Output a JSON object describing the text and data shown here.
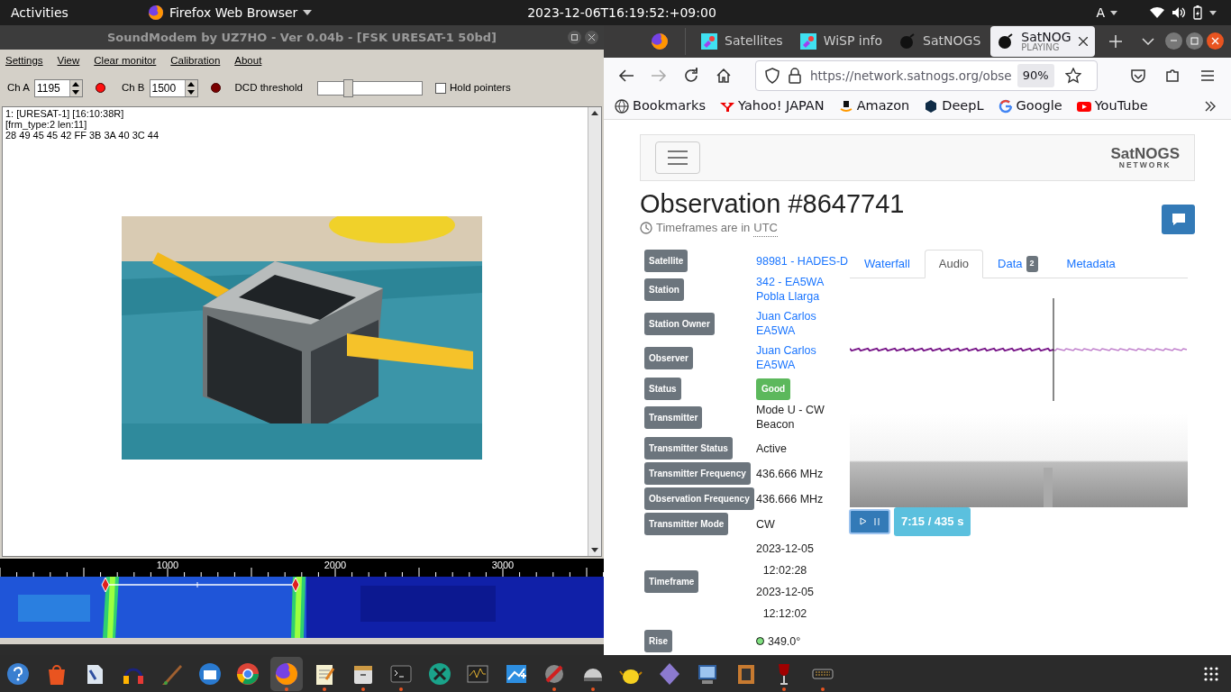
{
  "top_bar": {
    "activities": "Activities",
    "app": "Firefox Web Browser",
    "clock": "2023-12-06T16:19:52:+09:00",
    "input_source": "A"
  },
  "soundmodem": {
    "title": "SoundModem by UZ7HO - Ver 0.04b - [FSK URESAT-1 50bd]",
    "menu": [
      "Settings",
      "View",
      "Clear monitor",
      "Calibration",
      "About"
    ],
    "channels": [
      {
        "label": "Ch A",
        "value": "1195",
        "led_on": true
      },
      {
        "label": "Ch B",
        "value": "1500",
        "led_on": false
      }
    ],
    "dcd": {
      "label": "DCD threshold",
      "level": 0.27
    },
    "hold_pointers": {
      "label": "Hold pointers",
      "checked": false
    },
    "monitor_lines": [
      "1: [URESAT-1] [16:10:38R]",
      "[frm_type:2 len:11]",
      "28 49 45 45 42 FF 3B 3A 40 3C 44"
    ],
    "waterfall_ticks": [
      "1000",
      "2000",
      "3000"
    ]
  },
  "browser": {
    "tabs": [
      {
        "label": "Satellites",
        "selected": false
      },
      {
        "label": "WiSP info",
        "selected": false
      },
      {
        "label": "SatNOGS",
        "selected": false
      },
      {
        "label": "SatNOG",
        "status": "PLAYING",
        "selected": true
      }
    ],
    "url": "https://network.satnogs.org/obse",
    "zoom": "90%",
    "bookmarks": [
      "Bookmarks",
      "Yahoo! JAPAN",
      "Amazon",
      "DeepL",
      "Google",
      "YouTube"
    ]
  },
  "page": {
    "logo": {
      "name": "SatNOGS",
      "tagline": "NETWORK"
    },
    "title": "Observation #8647741",
    "timezone_note": "Timeframes are in",
    "timezone": "UTC",
    "details": [
      {
        "label": "Satellite",
        "kind": "link",
        "lines": [
          "98981 - HADES-D"
        ]
      },
      {
        "label": "Station",
        "kind": "link",
        "lines": [
          "342 - EA5WA",
          "Pobla Llarga"
        ]
      },
      {
        "label": "Station Owner",
        "kind": "link",
        "lines": [
          "Juan Carlos",
          "EA5WA"
        ]
      },
      {
        "label": "Observer",
        "kind": "link",
        "lines": [
          "Juan Carlos",
          "EA5WA"
        ]
      },
      {
        "label": "Status",
        "kind": "status",
        "lines": [
          "Good"
        ]
      },
      {
        "label": "Transmitter",
        "kind": "text",
        "lines": [
          "Mode U - CW",
          "Beacon"
        ]
      },
      {
        "label": "Transmitter Status",
        "kind": "text",
        "lines": [
          "Active"
        ]
      },
      {
        "label": "Transmitter Frequency",
        "kind": "text",
        "lines": [
          "436.666 MHz"
        ]
      },
      {
        "label": "Observation Frequency",
        "kind": "text",
        "lines": [
          "436.666 MHz"
        ]
      },
      {
        "label": "Transmitter Mode",
        "kind": "text",
        "lines": [
          "CW"
        ]
      },
      {
        "label": "Timeframe",
        "kind": "timeframe",
        "lines": [
          "2023-12-05",
          "12:02:28",
          "2023-12-05",
          "12:12:02"
        ]
      },
      {
        "label": "Rise",
        "kind": "azimuth",
        "lines": [
          "349.0°"
        ]
      }
    ],
    "tabs": [
      {
        "label": "Waterfall",
        "selected": false
      },
      {
        "label": "Audio",
        "selected": true
      },
      {
        "label": "Data",
        "badge": "2",
        "selected": false
      },
      {
        "label": "Metadata",
        "selected": false
      }
    ],
    "player": {
      "time": "7:15 / 435 s"
    }
  },
  "dock": {
    "apps": [
      {
        "running": false
      },
      {
        "running": false
      },
      {
        "running": false
      },
      {
        "running": false
      },
      {
        "running": false
      },
      {
        "running": false
      },
      {
        "running": false
      },
      {
        "running": true
      },
      {
        "running": true
      },
      {
        "running": true
      },
      {
        "running": true
      },
      {
        "running": false
      },
      {
        "running": false
      },
      {
        "running": false
      },
      {
        "running": true
      },
      {
        "running": true
      },
      {
        "running": false
      },
      {
        "running": false
      },
      {
        "running": false
      },
      {
        "running": false
      },
      {
        "running": true
      },
      {
        "running": true
      }
    ]
  }
}
